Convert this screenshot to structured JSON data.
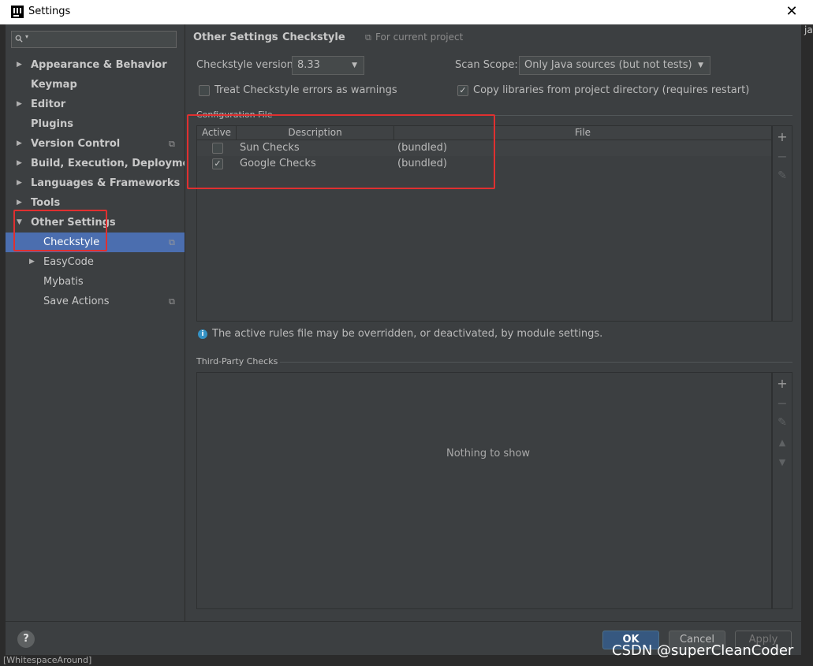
{
  "window": {
    "title": "Settings",
    "close_glyph": "✕"
  },
  "background": {
    "right_text": "ja",
    "bottom_text": "[WhitespaceAround]"
  },
  "search": {
    "placeholder": ""
  },
  "sidebar": {
    "items": [
      {
        "label": "Appearance & Behavior",
        "arrow": "▶",
        "bold": true
      },
      {
        "label": "Keymap",
        "arrow": "",
        "bold": true
      },
      {
        "label": "Editor",
        "arrow": "▶",
        "bold": true
      },
      {
        "label": "Plugins",
        "arrow": "",
        "bold": true
      },
      {
        "label": "Version Control",
        "arrow": "▶",
        "bold": true,
        "project_icon": "copy-icon"
      },
      {
        "label": "Build, Execution, Deployment",
        "arrow": "▶",
        "bold": true
      },
      {
        "label": "Languages & Frameworks",
        "arrow": "▶",
        "bold": true
      },
      {
        "label": "Tools",
        "arrow": "▶",
        "bold": true
      },
      {
        "label": "Other Settings",
        "arrow": "▼",
        "bold": true
      },
      {
        "label": "Checkstyle",
        "arrow": "",
        "bold": false,
        "selected": true,
        "project_icon": "copy-icon"
      },
      {
        "label": "EasyCode",
        "arrow": "▶",
        "bold": false
      },
      {
        "label": "Mybatis",
        "arrow": "",
        "bold": false
      },
      {
        "label": "Save Actions",
        "arrow": "",
        "bold": false,
        "project_icon": "copy-icon"
      }
    ],
    "project_glyph": "⧉"
  },
  "breadcrumb": {
    "parent": "Other Settings",
    "separator": "›",
    "current": "Checkstyle",
    "scope_note": "For current project"
  },
  "checkstyle": {
    "version_label": "Checkstyle version:",
    "version_value": "8.33",
    "scan_scope_label": "Scan Scope:",
    "scan_scope_value": "Only Java sources (but not tests)",
    "treat_errors_label": "Treat Checkstyle errors as warnings",
    "treat_errors_checked": false,
    "copy_libs_label": "Copy libraries from project directory (requires restart)",
    "copy_libs_checked": true
  },
  "config_file": {
    "section_title": "Configuration File",
    "columns": [
      "Active",
      "Description",
      "File"
    ],
    "rows": [
      {
        "active": false,
        "description": "Sun Checks",
        "file": "(bundled)"
      },
      {
        "active": true,
        "description": "Google Checks",
        "file": "(bundled)"
      }
    ],
    "toolbar": {
      "add": "+",
      "remove": "−",
      "edit": "✎"
    },
    "info_text": "The active rules file may be overridden, or deactivated, by module settings."
  },
  "third_party": {
    "section_title": "Third-Party Checks",
    "empty_text": "Nothing to show",
    "toolbar": {
      "add": "+",
      "remove": "−",
      "edit": "✎",
      "up": "▲",
      "down": "▼"
    }
  },
  "footer": {
    "help": "?",
    "ok": "OK",
    "cancel": "Cancel",
    "apply": "Apply"
  },
  "watermark": "CSDN @superCleanCoder",
  "colors": {
    "accent": "#4b6eaf",
    "highlight": "#e03030",
    "primary_button": "#365880"
  }
}
